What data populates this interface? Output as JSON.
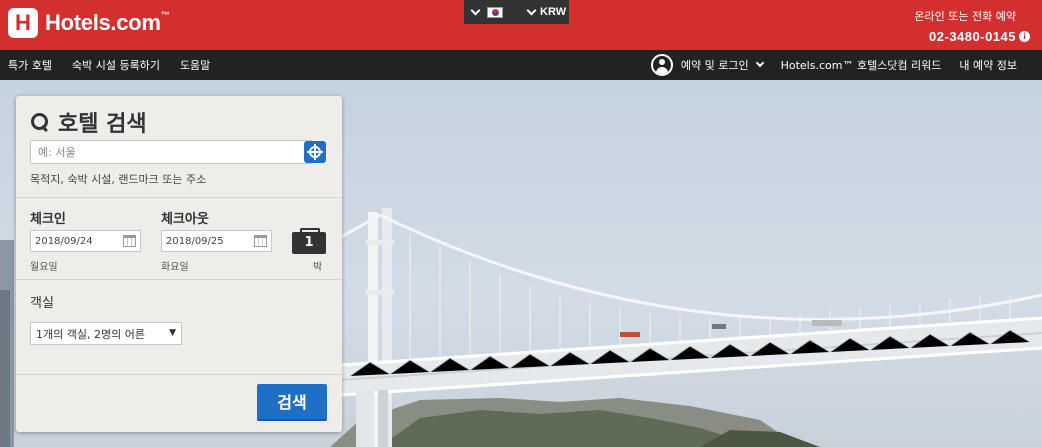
{
  "brand": {
    "logo_letter": "H",
    "name": "Hotels.com",
    "tm": "™"
  },
  "locale": {
    "country_flag": "south-korea-flag",
    "currency": "KRW"
  },
  "contact": {
    "label": "온라인 또는 전화 예약",
    "phone": "02-3480-0145"
  },
  "nav": {
    "left": [
      "특가 호텔",
      "숙박 시설 등록하기",
      "도움말"
    ],
    "login": "예약 및 로그인",
    "rewards": "Hotels.com™ 호텔스닷컴 리워드",
    "my_bookings": "내 예약 정보"
  },
  "search": {
    "title": "호텔 검색",
    "destination_placeholder": "예: 서울",
    "destination_value": "",
    "destination_hint": "목적지, 숙박 시설, 랜드마크 또는 주소",
    "checkin_label": "체크인",
    "checkin_date": "2018/09/24",
    "checkin_weekday": "월요일",
    "checkout_label": "체크아웃",
    "checkout_date": "2018/09/25",
    "checkout_weekday": "화요일",
    "nights": "1",
    "nights_unit": "박",
    "rooms_label": "객실",
    "rooms_value": "1개의 객실, 2명의 어른",
    "submit": "검색"
  },
  "colors": {
    "brand_red": "#d32f2f",
    "nav_dark": "#222222",
    "action_blue": "#1f6fc5"
  }
}
